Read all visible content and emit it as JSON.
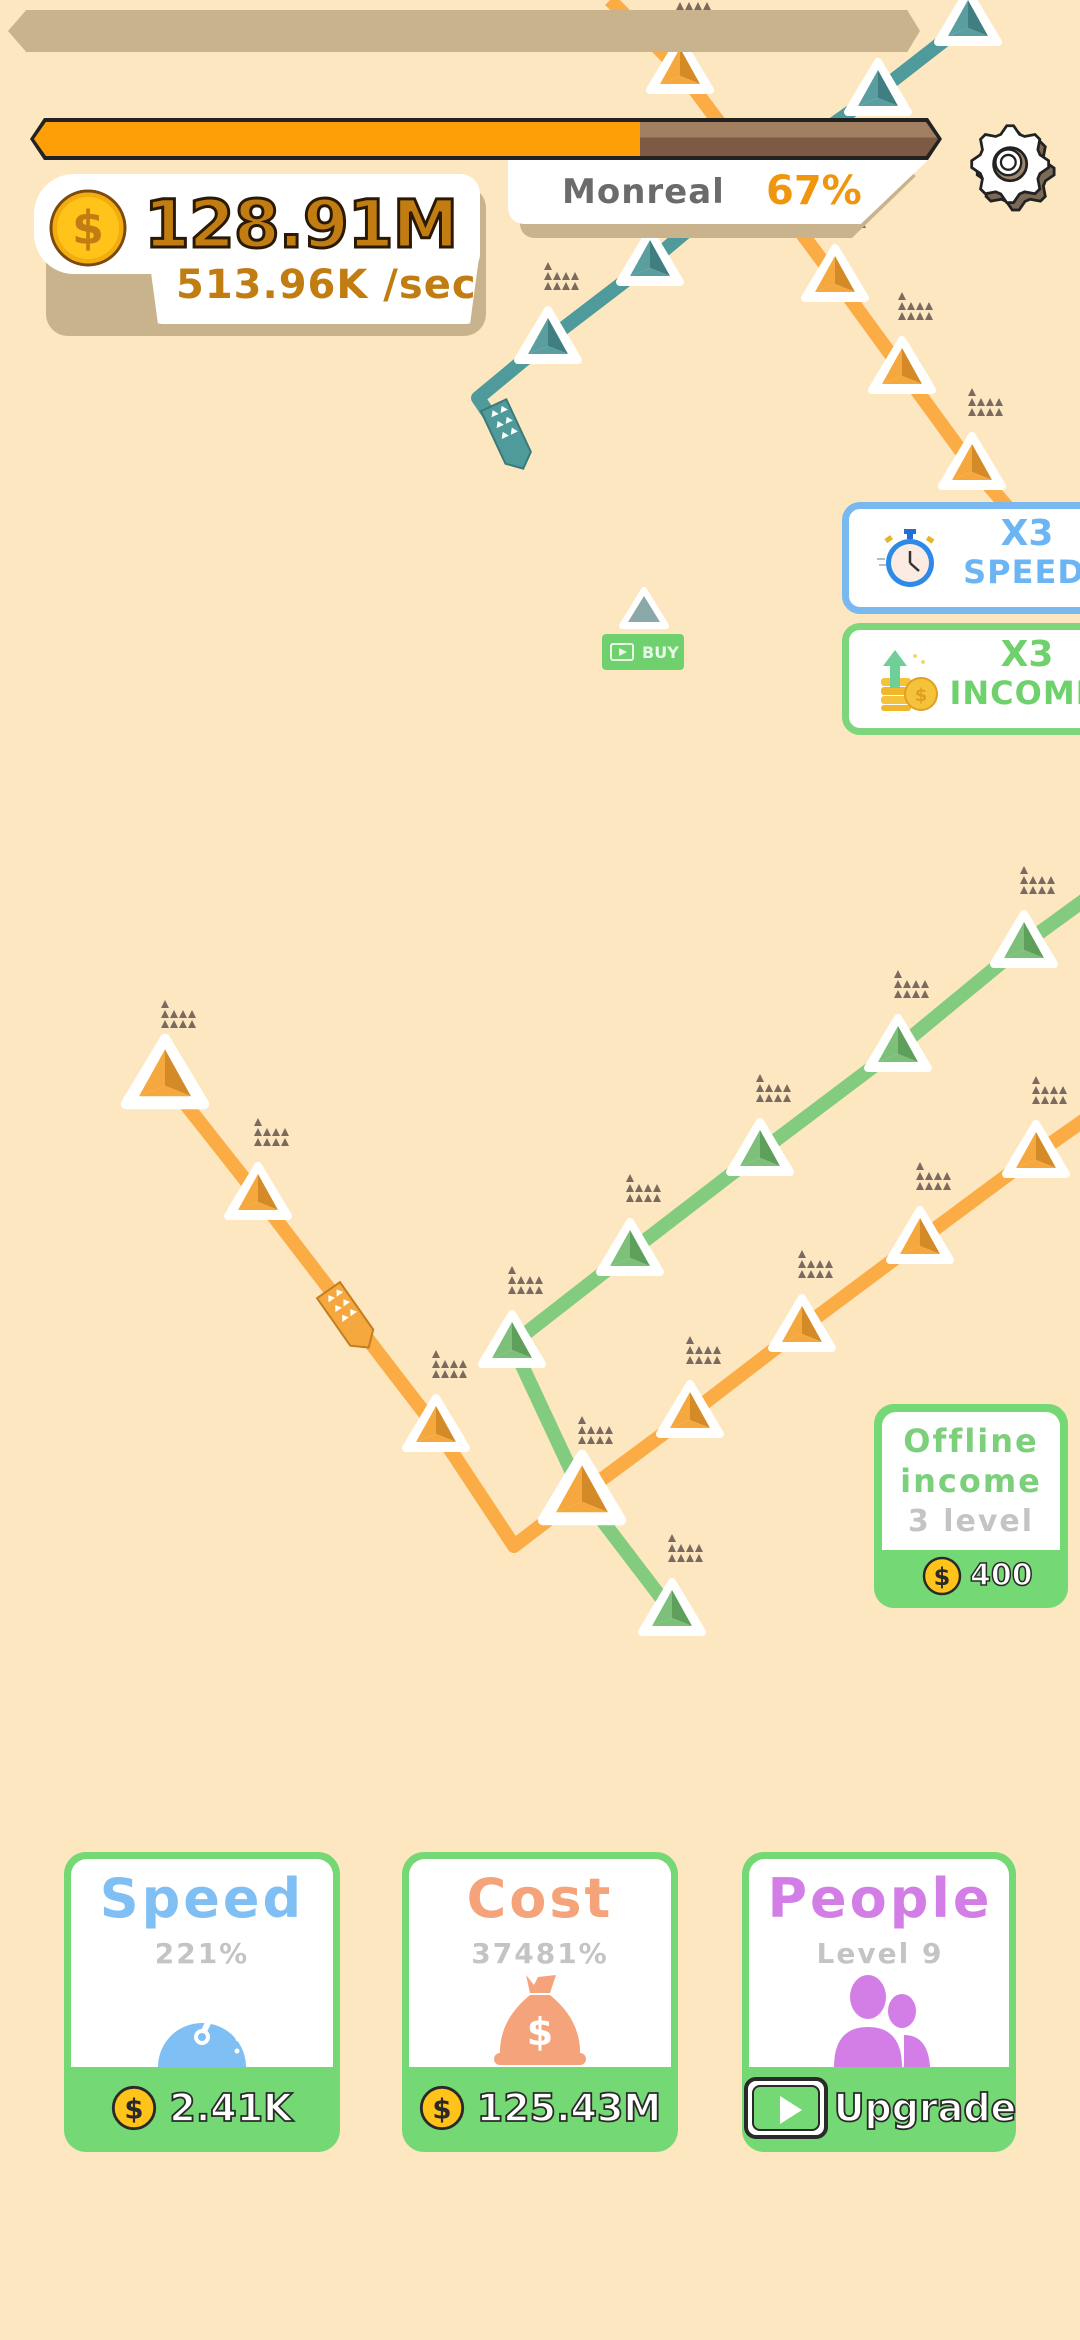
{
  "header": {
    "level_progress": 0.67,
    "city_name": "Monreal",
    "city_progress_label": "67%",
    "settings_icon": "gear-icon"
  },
  "wallet": {
    "balance": "128.91M",
    "income_rate": "513.96K /sec",
    "icon": "coin-icon"
  },
  "boosters": [
    {
      "multiplier": "X3",
      "label": "SPEED",
      "icon": "stopwatch-icon"
    },
    {
      "multiplier": "X3",
      "label": "INCOME",
      "icon": "coins-up-icon"
    }
  ],
  "buy_station": {
    "label": "BUY",
    "icon": "video-ad-icon"
  },
  "offline_income": {
    "line1": "Offline",
    "line2": "income",
    "level": "3 level",
    "cost": "400"
  },
  "upgrades": [
    {
      "title": "Speed",
      "subtitle": "221%",
      "icon": "speedometer-icon",
      "price": "2.41K"
    },
    {
      "title": "Cost",
      "subtitle": "37481%",
      "icon": "money-bag-icon",
      "price": "125.43M"
    },
    {
      "title": "People",
      "subtitle": "Level 9",
      "icon": "people-icon",
      "action": "Upgrade"
    }
  ],
  "colors": {
    "background": "#fde7c0",
    "orange_line": "#fbac45",
    "teal_line": "#4f9a9a",
    "green_line": "#82cb7f",
    "accent_green": "#74d874",
    "progress_fill": "#ff9f08"
  },
  "map": {
    "lines": [
      {
        "name": "teal-line",
        "color": "#4f9a9a",
        "stations": 5
      },
      {
        "name": "orange-line-north",
        "color": "#fbac45",
        "stations": 4
      },
      {
        "name": "orange-line-south",
        "color": "#fbac45",
        "stations": 9
      },
      {
        "name": "green-line",
        "color": "#82cb7f",
        "stations": 7
      }
    ]
  }
}
